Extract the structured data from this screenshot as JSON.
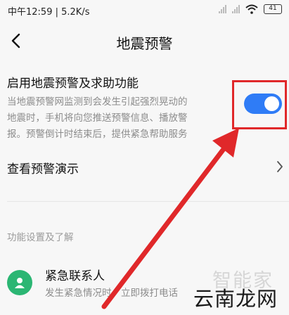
{
  "status_bar": {
    "time_speed": "中午12:59 | 5.2K/s",
    "battery": "41"
  },
  "header": {
    "title": "地震预警",
    "back_icon": "chevron-left-icon"
  },
  "earthquake_setting": {
    "title": "启用地震预警及求助功能",
    "description_lines": [
      "当地震预警网监测到会发生引起强烈晃动的",
      "地震时，手机将向您推送预警信息、播放警",
      "报。预警倒计时结束后，提供紧急帮助服务"
    ],
    "toggle_on": true,
    "toggle_color": "#2f7cf6"
  },
  "demo_row": {
    "label": "查看预警演示"
  },
  "section": {
    "header": "功能设置及了解"
  },
  "contact_row": {
    "title": "紧急联系人",
    "description": "发生紧急情况时，立即拨打电话"
  },
  "watermark": {
    "top": "智能家",
    "bottom": "云南龙网"
  },
  "annotation_color": "#e0282a"
}
